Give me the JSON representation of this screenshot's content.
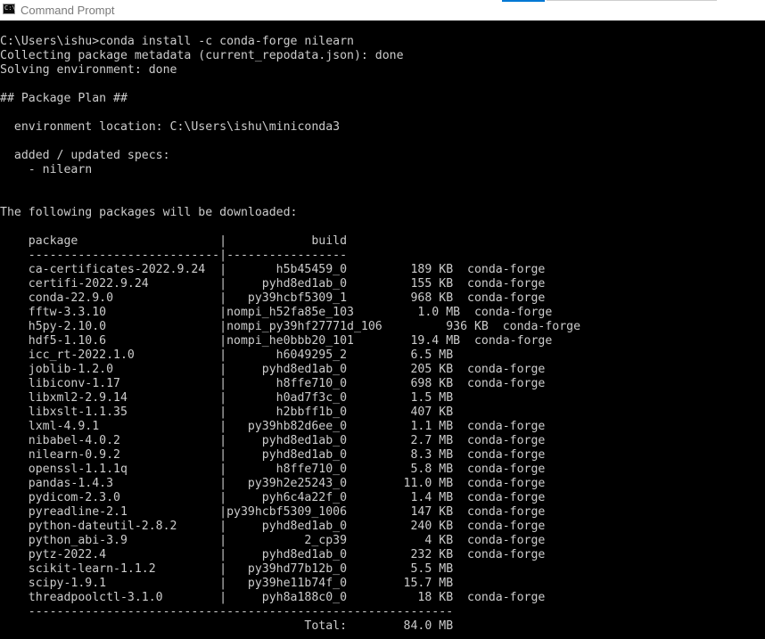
{
  "window": {
    "title": "Command Prompt",
    "icon": "console-app-icon",
    "icon_glyph": "C:\\",
    "accent_color": "#0078d4"
  },
  "console": {
    "background": "#000000",
    "foreground": "#cccccc",
    "lines": [
      "C:\\Users\\ishu>conda install -c conda-forge nilearn",
      "Collecting package metadata (current_repodata.json): done",
      "Solving environment: done",
      "",
      "## Package Plan ##",
      "",
      "  environment location: C:\\Users\\ishu\\miniconda3",
      "",
      "  added / updated specs:",
      "    - nilearn",
      "",
      "",
      "The following packages will be downloaded:",
      "",
      "    package                    |            build",
      "    ---------------------------|-----------------",
      "    ca-certificates-2022.9.24  |       h5b45459_0         189 KB  conda-forge",
      "    certifi-2022.9.24          |     pyhd8ed1ab_0         155 KB  conda-forge",
      "    conda-22.9.0               |   py39hcbf5309_1         968 KB  conda-forge",
      "    fftw-3.3.10                |nompi_h52fa85e_103         1.0 MB  conda-forge",
      "    h5py-2.10.0                |nompi_py39hf27771d_106         936 KB  conda-forge",
      "    hdf5-1.10.6                |nompi_he0bbb20_101        19.4 MB  conda-forge",
      "    icc_rt-2022.1.0            |       h6049295_2         6.5 MB",
      "    joblib-1.2.0               |     pyhd8ed1ab_0         205 KB  conda-forge",
      "    libiconv-1.17              |       h8ffe710_0         698 KB  conda-forge",
      "    libxml2-2.9.14             |       h0ad7f3c_0         1.5 MB",
      "    libxslt-1.1.35             |       h2bbff1b_0         407 KB",
      "    lxml-4.9.1                 |   py39hb82d6ee_0         1.1 MB  conda-forge",
      "    nibabel-4.0.2              |     pyhd8ed1ab_0         2.7 MB  conda-forge",
      "    nilearn-0.9.2              |     pyhd8ed1ab_0         8.3 MB  conda-forge",
      "    openssl-1.1.1q             |       h8ffe710_0         5.8 MB  conda-forge",
      "    pandas-1.4.3               |   py39h2e25243_0        11.0 MB  conda-forge",
      "    pydicom-2.3.0              |     pyh6c4a22f_0         1.4 MB  conda-forge",
      "    pyreadline-2.1             |py39hcbf5309_1006         147 KB  conda-forge",
      "    python-dateutil-2.8.2      |     pyhd8ed1ab_0         240 KB  conda-forge",
      "    python_abi-3.9             |           2_cp39           4 KB  conda-forge",
      "    pytz-2022.4                |     pyhd8ed1ab_0         232 KB  conda-forge",
      "    scikit-learn-1.1.2         |   py39hd77b12b_0         5.5 MB",
      "    scipy-1.9.1                |   py39he11b74f_0        15.7 MB",
      "    threadpoolctl-3.1.0        |     pyh8a188c0_0          18 KB  conda-forge",
      "    ------------------------------------------------------------",
      "                                           Total:        84.0 MB"
    ]
  }
}
